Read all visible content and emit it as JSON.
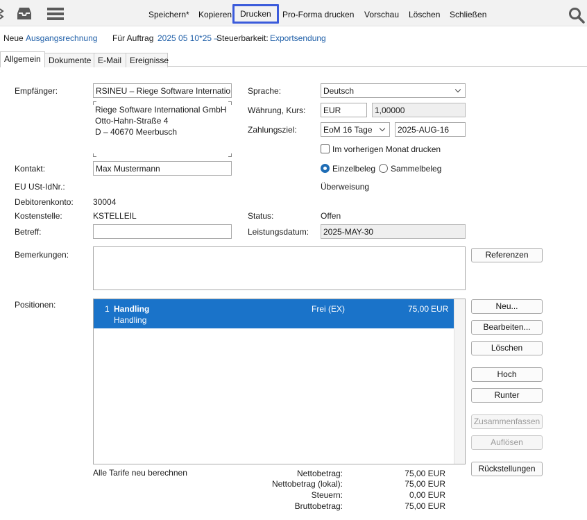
{
  "toolbar": {
    "items": [
      "Speichern*",
      "Kopieren",
      "Drucken",
      "Pro-Forma drucken",
      "Vorschau",
      "Löschen",
      "Schließen"
    ]
  },
  "header": {
    "new_label": "Neue",
    "doc_type": "Ausgangsrechnung",
    "order_label": "Für Auftrag",
    "order_value": "2025 05 10*25 –",
    "tax_label": "Steuerbarkeit:",
    "tax_value": "Exportsendung"
  },
  "tabs": [
    "Allgemein",
    "Dokumente",
    "E-Mail",
    "Ereignisse"
  ],
  "form": {
    "recipient_label": "Empfänger:",
    "recipient_value": "RSINEU – Riege Software International GmbH",
    "address_lines": [
      "Riege Software International GmbH",
      "Otto-Hahn-Straße 4",
      "D – 40670 Meerbusch"
    ],
    "contact_label": "Kontakt:",
    "contact_value": "Max Mustermann",
    "vat_label": "EU USt-IdNr.:",
    "debitor_label": "Debitorenkonto:",
    "debitor_value": "30004",
    "cost_center_label": "Kostenstelle:",
    "cost_center_value": "KSTELLEIL",
    "subject_label": "Betreff:",
    "subject_value": "",
    "language_label": "Sprache:",
    "language_value": "Deutsch",
    "currency_label": "Währung, Kurs:",
    "currency_value": "EUR",
    "rate_value": "1,00000",
    "terms_label": "Zahlungsziel:",
    "terms_value": "EoM 16 Tage",
    "due_date": "2025-AUG-16",
    "prev_month_label": "Im vorherigen Monat drucken",
    "single_label": "Einzelbeleg",
    "collective_label": "Sammelbeleg",
    "transfer_link": "Überweisung",
    "status_label": "Status:",
    "status_value": "Offen",
    "service_date_label": "Leistungsdatum:",
    "service_date_value": "2025-MAY-30",
    "remarks_label": "Bemerkungen:",
    "positions_label": "Positionen:"
  },
  "positions": [
    {
      "num": "1",
      "title": "Handling",
      "subtitle": "Handling",
      "tax": "Frei (EX)",
      "amount": "75,00",
      "currency": "EUR"
    }
  ],
  "buttons": {
    "references": "Referenzen",
    "new": "Neu...",
    "edit": "Bearbeiten...",
    "delete": "Löschen",
    "up": "Hoch",
    "down": "Runter",
    "merge": "Zusammenfassen",
    "split": "Auflösen",
    "provisions": "Rückstellungen"
  },
  "recalc_link": "Alle Tarife neu berechnen",
  "totals": [
    {
      "label": "Nettobetrag:",
      "value": "75,00 EUR"
    },
    {
      "label": "Nettobetrag (lokal):",
      "value": "75,00 EUR"
    },
    {
      "label": "Steuern:",
      "value": "0,00 EUR"
    },
    {
      "label": "Bruttobetrag:",
      "value": "75,00 EUR"
    }
  ],
  "colors": {
    "accent": "#1f6db5",
    "selection": "#1a73c9",
    "highlight_border": "#3b5bdb"
  }
}
